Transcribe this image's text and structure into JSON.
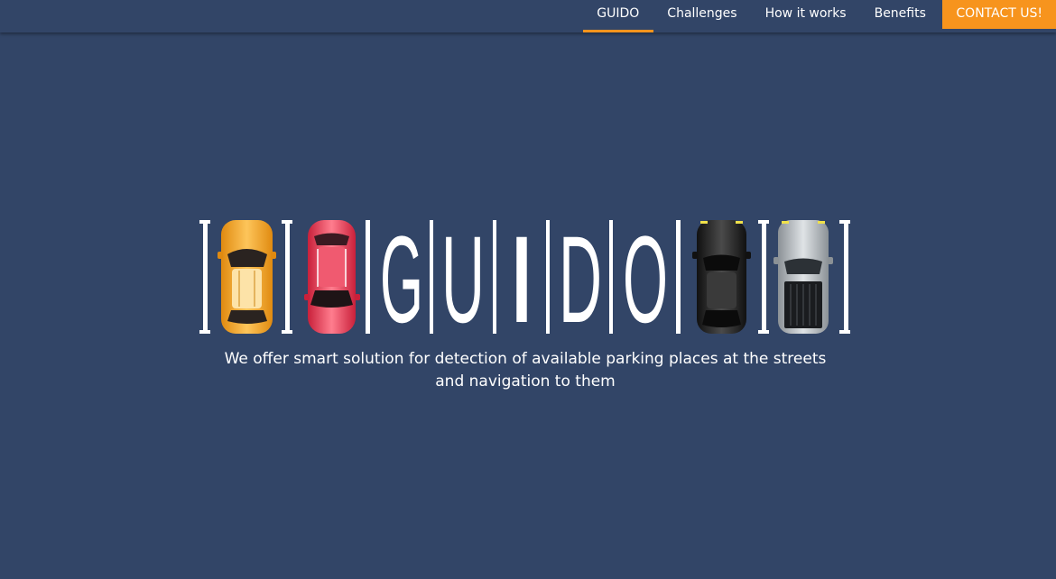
{
  "nav": {
    "items": [
      {
        "label": "GUIDO",
        "active": true
      },
      {
        "label": "Challenges",
        "active": false
      },
      {
        "label": "How it works",
        "active": false
      },
      {
        "label": "Benefits",
        "active": false
      }
    ],
    "contact_label": "CONTACT US!"
  },
  "hero": {
    "logo_letters": [
      "G",
      "U",
      "I",
      "D",
      "O"
    ],
    "tagline": "We offer smart solution for detection of available parking places at the streets and navigation to them"
  },
  "colors": {
    "background": "#324567",
    "accent": "#f7941d",
    "text": "#ffffff"
  },
  "icons": {
    "cars": [
      "orange-car-icon",
      "red-car-icon",
      "black-car-icon",
      "silver-pickup-icon"
    ]
  }
}
